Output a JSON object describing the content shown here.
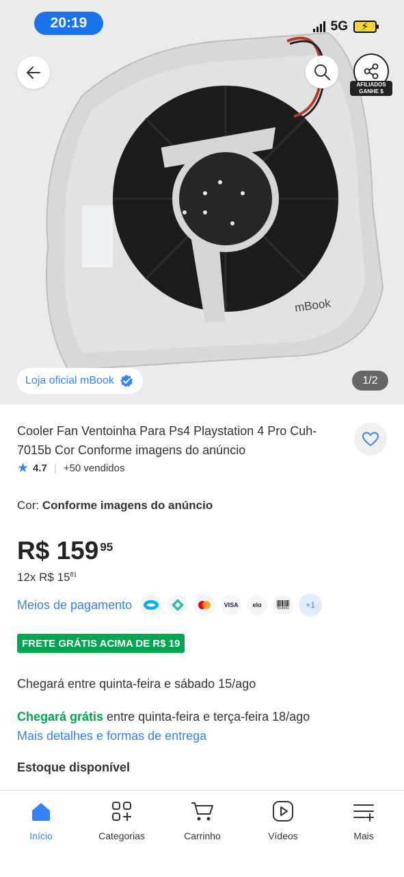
{
  "status_bar": {
    "time": "20:19",
    "network": "5G"
  },
  "product_image": {
    "brand_watermark": "mBook",
    "store_label": "Loja oficial mBook",
    "page_indicator": "1/2"
  },
  "header": {
    "affiliate_label_line1": "AFILIADOS",
    "affiliate_label_line2": "GANHE $"
  },
  "product": {
    "title": "Cooler Fan Ventoinha Para Ps4 Playstation 4 Pro Cuh-7015b Cor Conforme imagens do anúncio",
    "rating": "4.7",
    "sold": "+50 vendidos",
    "color_label": "Cor:",
    "color_value": "Conforme imagens do anúncio",
    "price_main": "R$ 159",
    "price_cents": "95",
    "installment_prefix": "12x R$ 15",
    "installment_cents": "81",
    "payment_link": "Meios de pagamento",
    "payment_more": "+1",
    "payment_visa": "VISA",
    "payment_elo": "elo",
    "payment_boleto": "Boleto",
    "shipping_badge": "FRETE GRÁTIS ACIMA DE R$ 19",
    "arrival_text": "Chegará entre quinta-feira e sábado 15/ago",
    "arrival_free_label": "Chegará grátis",
    "arrival_free_text": " entre quinta-feira e terça-feira 18/ago",
    "shipping_details_link": "Mais detalhes e formas de entrega",
    "stock_text": "Estoque disponível"
  },
  "bottom_nav": {
    "items": [
      {
        "label": "Início"
      },
      {
        "label": "Categorias"
      },
      {
        "label": "Carrinho"
      },
      {
        "label": "Vídeos"
      },
      {
        "label": "Mais"
      }
    ]
  },
  "colors": {
    "accent_blue": "#3483fa",
    "success_green": "#00a650",
    "time_pill": "#1a73e8"
  }
}
